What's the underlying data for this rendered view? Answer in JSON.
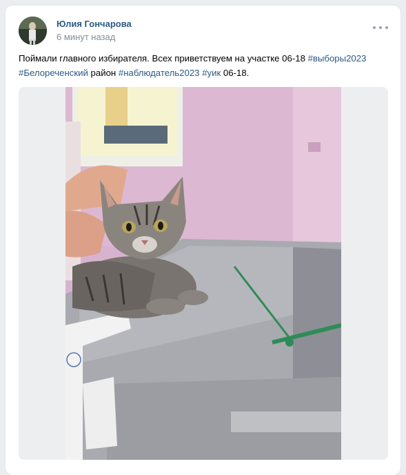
{
  "post": {
    "author": "Юлия Гончарова",
    "time": "6 минут назад",
    "text_parts": [
      {
        "text": "Поймали главного избирателя. Всех приветствуем на участке 06-18 ",
        "tag": false
      },
      {
        "text": "#выборы2023",
        "tag": true
      },
      {
        "text": " ",
        "tag": false
      },
      {
        "text": "#Белореченский",
        "tag": true
      },
      {
        "text": " район ",
        "tag": false
      },
      {
        "text": "#наблюдатель2023",
        "tag": true
      },
      {
        "text": " ",
        "tag": false
      },
      {
        "text": "#уик",
        "tag": true
      },
      {
        "text": " 06-18.",
        "tag": false
      }
    ]
  },
  "icons": {
    "menu": "more-horizontal-icon"
  },
  "colors": {
    "link": "#2a5885",
    "muted": "#818c99",
    "background": "#ebedf0"
  }
}
